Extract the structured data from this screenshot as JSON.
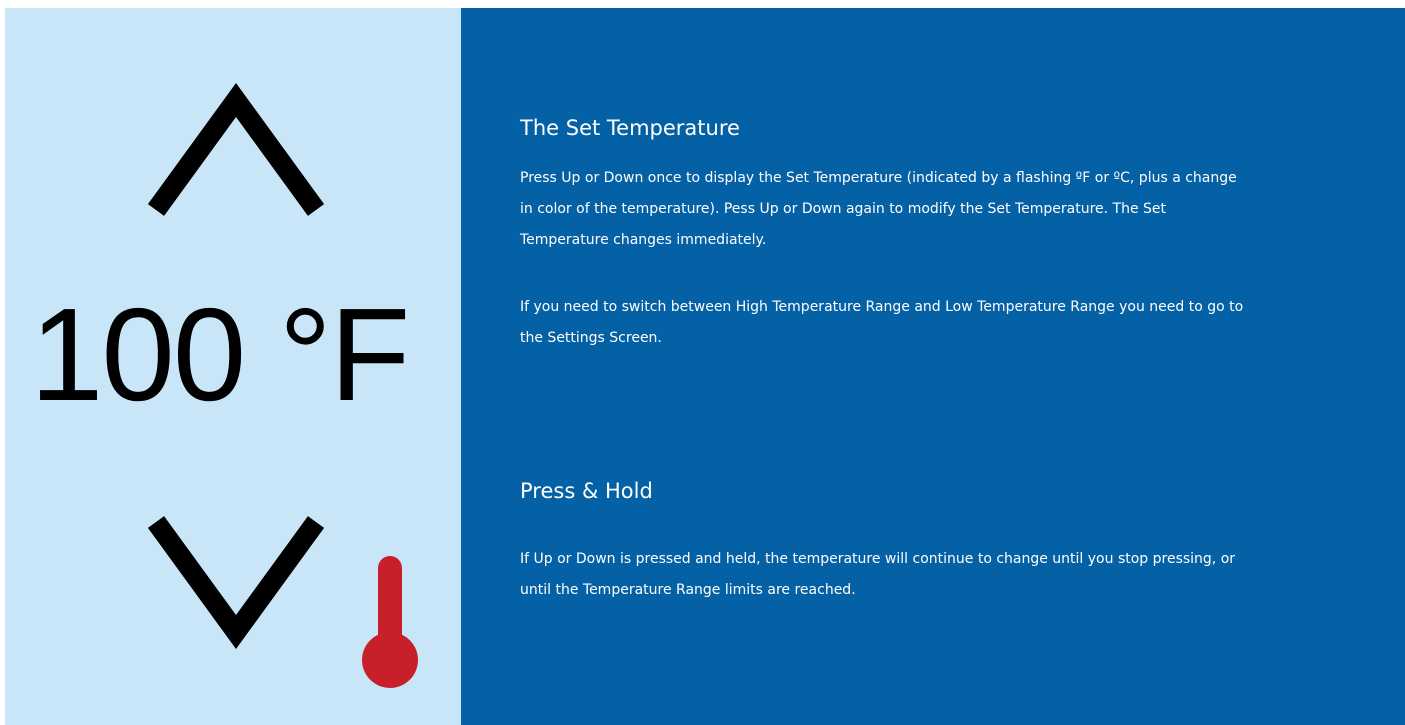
{
  "display": {
    "temperature": "100 °F",
    "up_control": "chevron-up-icon",
    "down_control": "chevron-down-icon",
    "indicator": "thermometer-icon"
  },
  "sections": [
    {
      "title": "The Set Temperature",
      "paragraphs": [
        "Press Up or Down once to display the Set Temperature (indicated by a flashing ºF or ºC, plus a change in color of the temperature). Pess Up or Down again to modify the Set Temperature. The Set Temperature changes immediately.",
        "If you need to switch between High Temperature Range and Low Temperature Range you need to go to the Settings Screen."
      ]
    },
    {
      "title": "Press & Hold",
      "paragraphs": [
        "If Up or Down is pressed and held, the temperature will continue to change until you stop pressing, or until the Temperature Range limits are reached."
      ]
    }
  ],
  "colors": {
    "left_panel": "#c9e6f8",
    "right_panel": "#0561a6",
    "thermometer": "#c8202a",
    "text": "#ffffff"
  }
}
